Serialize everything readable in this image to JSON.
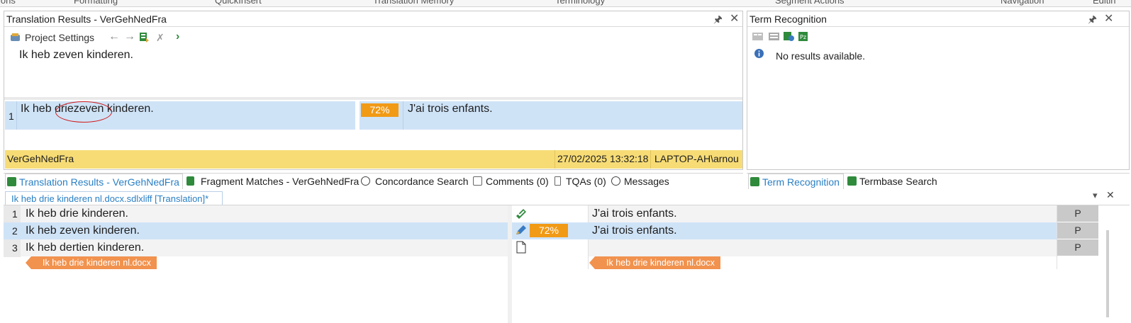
{
  "ribbon": {
    "groups": [
      "ions",
      "Formatting",
      "QuickInsert",
      "Translation Memory",
      "Terminology",
      "Segment Actions",
      "Navigation",
      "Editin"
    ]
  },
  "translation_results": {
    "title": "Translation Results - VerGehNedFra",
    "toolbar": {
      "project_settings": "Project Settings"
    },
    "source_preview": "Ik heb zeven kinderen.",
    "result": {
      "number": "1",
      "source_prefix": "Ik heb ",
      "source_deleted": "drie",
      "source_inserted": "zeven",
      "source_suffix": " kinderen.",
      "match": "72%",
      "target": "J'ai trois enfants."
    },
    "status": {
      "tm_name": "VerGehNedFra",
      "date": "27/02/2025 13:32:18",
      "user": "LAPTOP-AH\\arnou"
    }
  },
  "term_recognition": {
    "title": "Term Recognition",
    "message": "No results available."
  },
  "tabs_left": [
    {
      "label": "Translation Results - VerGehNedFra",
      "active": true
    },
    {
      "label": "Fragment Matches - VerGehNedFra",
      "active": false
    },
    {
      "label": "Concordance Search",
      "active": false
    },
    {
      "label": "Comments (0)",
      "active": false
    },
    {
      "label": "TQAs (0)",
      "active": false
    },
    {
      "label": "Messages",
      "active": false
    }
  ],
  "tabs_right": [
    {
      "label": "Term Recognition",
      "active": true
    },
    {
      "label": "Termbase Search",
      "active": false
    }
  ],
  "editor": {
    "document_tab": "Ik heb drie kinderen nl.docx.sdlxliff [Translation]*",
    "rows": [
      {
        "number": "1",
        "source": "Ik heb drie kinderen.",
        "match": "",
        "target": "J'ai trois enfants.",
        "status": "P"
      },
      {
        "number": "2",
        "source": "Ik heb zeven kinderen.",
        "match": "72%",
        "target": "J'ai trois enfants.",
        "status": "P"
      },
      {
        "number": "3",
        "source": "Ik heb dertien kinderen.",
        "match": "",
        "target": "",
        "status": "P"
      }
    ],
    "file_tag": "Ik heb drie kinderen nl.docx"
  },
  "colors": {
    "selected_row": "#cfe3f7",
    "status_bar": "#f7dc76",
    "match_badge": "#f19a16",
    "file_tag": "#f1924e",
    "active_tab_text": "#2a7fc4",
    "tracked_change_circle": "#d01a1a"
  }
}
